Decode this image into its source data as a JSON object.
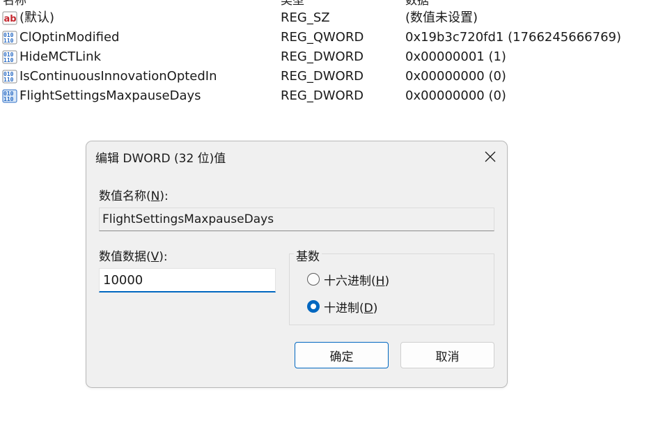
{
  "list": {
    "headers": {
      "name": "名称",
      "type": "类型",
      "data": "数据"
    },
    "rows": [
      {
        "icon": "string-value-icon",
        "name": "(默认)",
        "type": "REG_SZ",
        "data": "(数值未设置)"
      },
      {
        "icon": "binary-value-icon",
        "name": "ClOptinModified",
        "type": "REG_QWORD",
        "data": "0x19b3c720fd1 (1766245666769)"
      },
      {
        "icon": "binary-value-icon",
        "name": "HideMCTLink",
        "type": "REG_DWORD",
        "data": "0x00000001 (1)"
      },
      {
        "icon": "binary-value-icon",
        "name": "IsContinuousInnovationOptedIn",
        "type": "REG_DWORD",
        "data": "0x00000000 (0)"
      },
      {
        "icon": "binary-value-icon",
        "name": "FlightSettingsMaxpauseDays",
        "type": "REG_DWORD",
        "data": "0x00000000 (0)"
      }
    ]
  },
  "dialog": {
    "title": "编辑 DWORD (32 位)值",
    "value_name_label_pre": "数值名称(",
    "value_name_label_key": "N",
    "value_name_label_post": "):",
    "value_name": "FlightSettingsMaxpauseDays",
    "value_data_label_pre": "数值数据(",
    "value_data_label_key": "V",
    "value_data_label_post": "):",
    "value_data": "10000",
    "base_group_label": "基数",
    "radio_hex_pre": "十六进制(",
    "radio_hex_key": "H",
    "radio_hex_post": ")",
    "radio_dec_pre": "十进制(",
    "radio_dec_key": "D",
    "radio_dec_post": ")",
    "selected_base": "decimal",
    "ok_label": "确定",
    "cancel_label": "取消"
  },
  "colors": {
    "accent": "#0067c0",
    "dialog_bg": "#f0f0f0",
    "icon_blue": "#2b6cc4",
    "icon_red": "#c4262e"
  }
}
